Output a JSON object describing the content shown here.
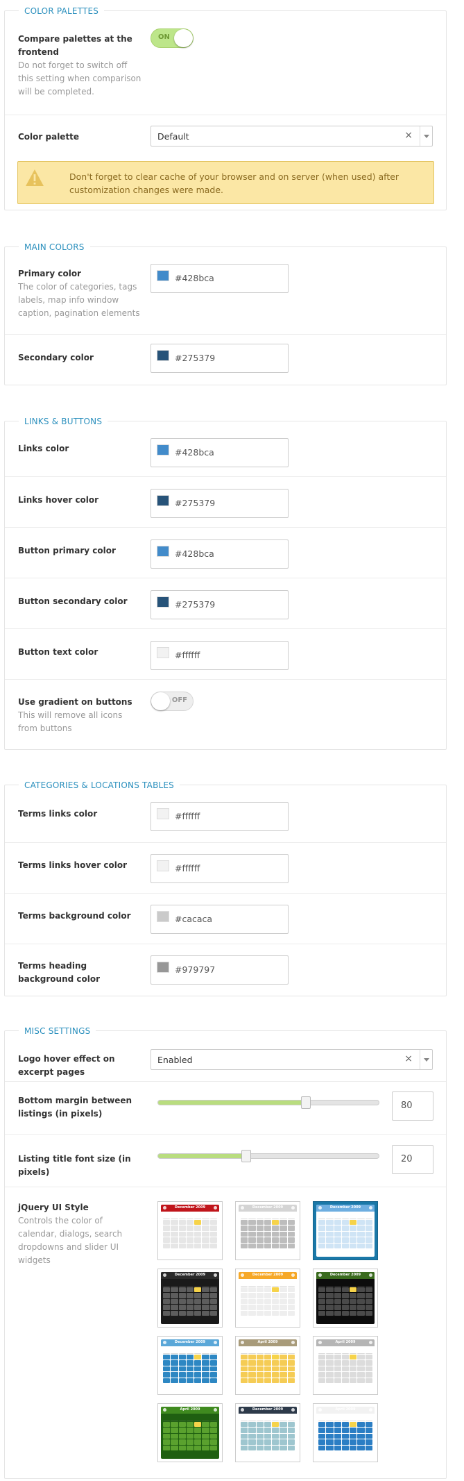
{
  "sections": {
    "color_palettes": {
      "legend": "COLOR PALETTES",
      "compare": {
        "label": "Compare palettes at the frontend",
        "desc": "Do not forget to switch off this setting when comparison will be completed.",
        "toggle": "ON"
      },
      "palette": {
        "label": "Color palette",
        "value": "Default",
        "clear": "×"
      },
      "warning": "Don't forget to clear cache of your browser and on server (when used) after customization changes were made."
    },
    "main_colors": {
      "legend": "MAIN COLORS",
      "primary": {
        "label": "Primary color",
        "desc": "The color of categories, tags labels, map info window caption, pagination elements",
        "value": "#428bca"
      },
      "secondary": {
        "label": "Secondary color",
        "value": "#275379"
      }
    },
    "links_buttons": {
      "legend": "LINKS & BUTTONS",
      "links": {
        "label": "Links color",
        "value": "#428bca"
      },
      "links_hover": {
        "label": "Links hover color",
        "value": "#275379"
      },
      "btn_primary": {
        "label": "Button primary color",
        "value": "#428bca"
      },
      "btn_secondary": {
        "label": "Button secondary color",
        "value": "#275379"
      },
      "btn_text": {
        "label": "Button text color",
        "value": "#ffffff"
      },
      "gradient": {
        "label": "Use gradient on buttons",
        "desc": "This will remove all icons from buttons",
        "toggle": "OFF"
      }
    },
    "tables": {
      "legend": "CATEGORIES & LOCATIONS TABLES",
      "terms_links": {
        "label": "Terms links color",
        "value": "#ffffff"
      },
      "terms_links_hover": {
        "label": "Terms links hover color",
        "value": "#ffffff"
      },
      "terms_bg": {
        "label": "Terms background color",
        "value": "#cacaca"
      },
      "terms_heading_bg": {
        "label": "Terms heading background color",
        "value": "#979797"
      }
    },
    "misc": {
      "legend": "MISC SETTINGS",
      "logo_hover": {
        "label": "Logo hover effect on excerpt pages",
        "value": "Enabled",
        "clear": "×"
      },
      "bottom_margin": {
        "label": "Bottom margin between listings (in pixels)",
        "value": "80",
        "level": 0.67
      },
      "title_font": {
        "label": "Listing title font size (in pixels)",
        "value": "20",
        "level": 0.4
      },
      "jquery_ui": {
        "label": "jQuery UI Style",
        "desc": "Controls the color of calendar, dialogs, search dropdowns and slider UI widgets"
      }
    }
  },
  "swatch_colors": {
    "blue": "#428bca",
    "dark": "#275379",
    "white": "#f2f2f2",
    "grey": "#cacaca",
    "darkgrey": "#979797"
  },
  "calendar_themes": [
    {
      "title": "December 2009",
      "head": "#c0151b",
      "body": "#ffffff",
      "cell": "#e6e6e6",
      "selected": false
    },
    {
      "title": "December 2009",
      "head": "#d4d4d4",
      "body": "#ffffff",
      "cell": "#bdbdbd",
      "selected": false
    },
    {
      "title": "December 2009",
      "head": "#6eaee0",
      "body": "#ffffff",
      "cell": "#cfe4f5",
      "selected": true
    },
    {
      "title": "December 2009",
      "head": "#2b2b2b",
      "body": "#1a1a1a",
      "cell": "#5d5d5d",
      "selected": false
    },
    {
      "title": "December 2009",
      "head": "#f6a828",
      "body": "#ffffff",
      "cell": "#eeeeee",
      "selected": false
    },
    {
      "title": "December 2009",
      "head": "#3a6b1e",
      "body": "#0c0c0c",
      "cell": "#4a4a4a",
      "selected": false
    },
    {
      "title": "December 2009",
      "head": "#5aa7d8",
      "body": "#ffffff",
      "cell": "#2d87c3",
      "selected": false
    },
    {
      "title": "April 2009",
      "head": "#a89b7a",
      "body": "#ffffff",
      "cell": "#f5cc55",
      "selected": false
    },
    {
      "title": "April 2009",
      "head": "#b5b5b5",
      "body": "#ffffff",
      "cell": "#dcdcdc",
      "selected": false
    },
    {
      "title": "April 2009",
      "head": "#3f8a1f",
      "body": "#1f5f11",
      "cell": "#5aa12e",
      "selected": false
    },
    {
      "title": "December 2009",
      "head": "#2d3a4a",
      "body": "#ffffff",
      "cell": "#9ec6cf",
      "selected": false
    },
    {
      "title": "April 2009",
      "head": "#f2f2f2",
      "body": "#ffffff",
      "cell": "#2b7ec4",
      "selected": false
    }
  ]
}
